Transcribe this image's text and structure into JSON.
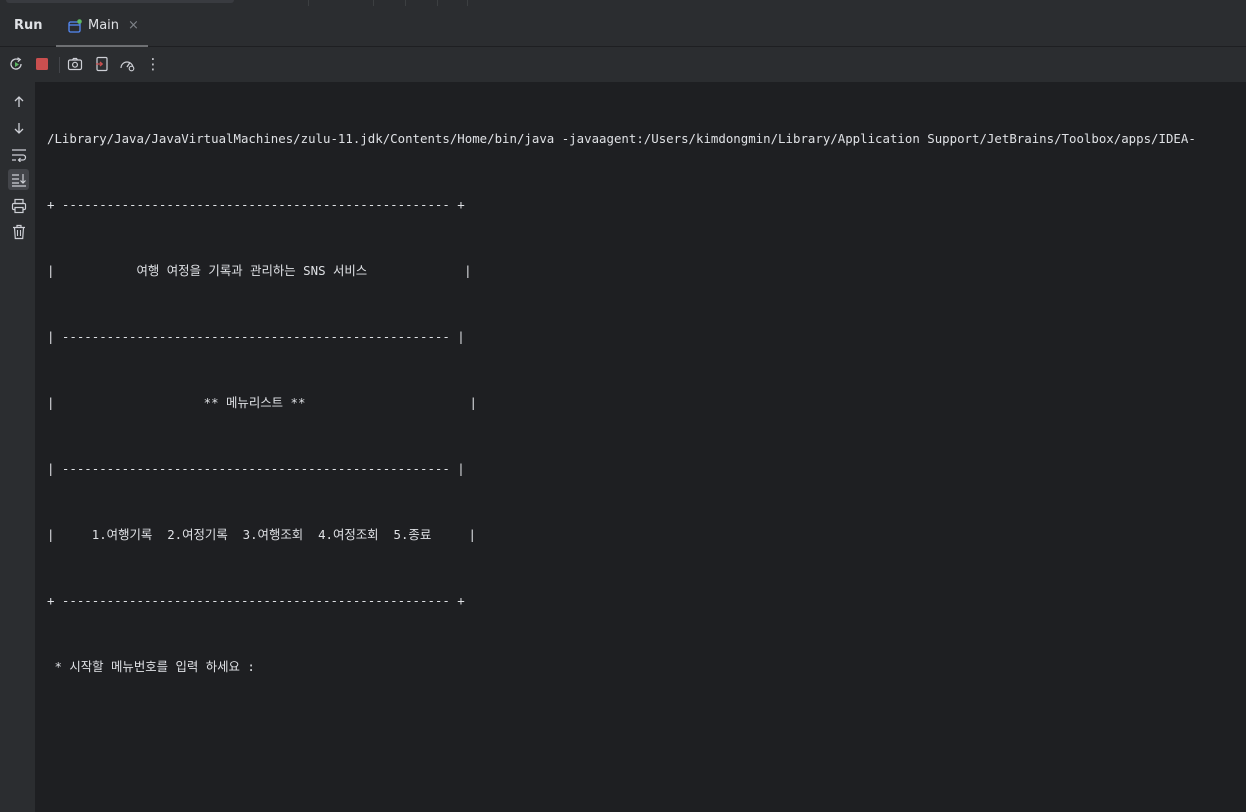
{
  "tool_window": {
    "run_label": "Run",
    "tab": {
      "label": "Main",
      "close": "×"
    }
  },
  "toolbar": {
    "icons": [
      "rerun-icon",
      "stop-icon",
      "screenshot-icon",
      "restore-icon",
      "profiler-icon",
      "more-icon"
    ],
    "more_label": "⋮"
  },
  "gutter": {
    "icons": [
      "up-arrow-icon",
      "down-arrow-icon",
      "soft-wrap-icon",
      "scroll-to-end-icon",
      "print-icon",
      "trash-icon"
    ]
  },
  "console": {
    "lines": [
      "/Library/Java/JavaVirtualMachines/zulu-11.jdk/Contents/Home/bin/java -javaagent:/Users/kimdongmin/Library/Application Support/JetBrains/Toolbox/apps/IDEA-",
      "+ ---------------------------------------------------- +",
      "|           여행 여정을 기록과 관리하는 SNS 서비스             |",
      "| ---------------------------------------------------- |",
      "|                    ** 메뉴리스트 **                      |",
      "| ---------------------------------------------------- |",
      "|     1.여행기록  2.여정기록  3.여행조회  4.여정조회  5.종료     |",
      "+ ---------------------------------------------------- +",
      " * 시작할 메뉴번호를 입력 하세요 :"
    ]
  },
  "colors": {
    "background": "#1e1f22",
    "panel": "#2b2d30",
    "stop": "#c94f4f",
    "rerun": "#5fb865"
  }
}
